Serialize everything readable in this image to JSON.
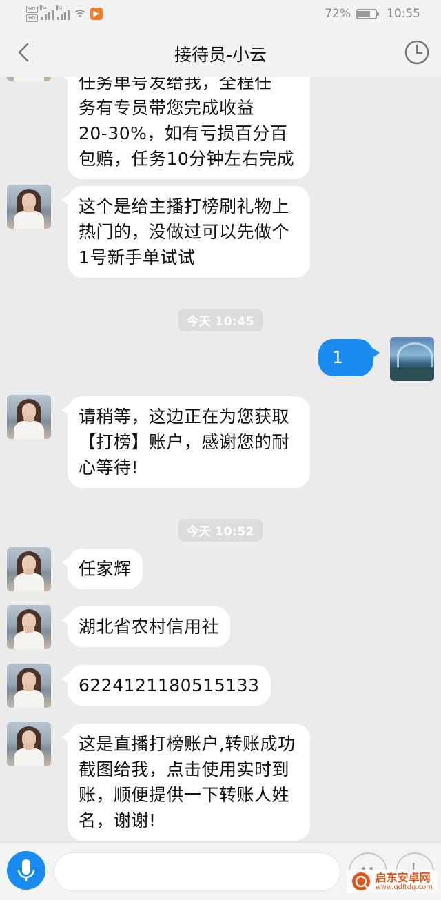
{
  "status_bar": {
    "badges": [
      "HD",
      "HD"
    ],
    "net_labels": [
      "4G",
      "5G"
    ],
    "battery": "72%",
    "battery_level": 0.72,
    "time": "10:55"
  },
  "nav": {
    "title": "接待员-小云"
  },
  "messages": [
    {
      "direction": "in",
      "lines": [
        "任务单号发给我，全程任",
        "务有专员带您完成收益",
        "20-30%，如有亏损百分百",
        "包赔，任务10分钟左右完成"
      ]
    },
    {
      "direction": "in",
      "lines": [
        "这个是给主播打榜刷礼物上",
        "热门的，没做过可以先做个",
        "1号新手单试试"
      ]
    },
    {
      "timestamp": "今天 10:45"
    },
    {
      "direction": "out",
      "text": "1"
    },
    {
      "direction": "in",
      "lines": [
        "请稍等，这边正在为您获取",
        "【打榜】账户，感谢您的耐",
        "心等待!"
      ]
    },
    {
      "timestamp": "今天 10:52"
    },
    {
      "direction": "in",
      "text": "任家辉"
    },
    {
      "direction": "in",
      "text": "湖北省农村信用社"
    },
    {
      "direction": "in",
      "text": "6224121180515133"
    },
    {
      "direction": "in",
      "lines": [
        "这是直播打榜账户,转账成功",
        "截图给我，点击使用实时到",
        "账，顺便提供一下转账人姓",
        "名，谢谢!"
      ]
    }
  ],
  "input": {
    "value": "",
    "placeholder": ""
  },
  "watermark": {
    "name": "启东安卓网",
    "url": "www.qdltdg.com"
  },
  "colors": {
    "accent": "#1a8cf0",
    "background": "#ebebeb",
    "bubble_in": "#ffffff",
    "watermark": "#e35215"
  }
}
